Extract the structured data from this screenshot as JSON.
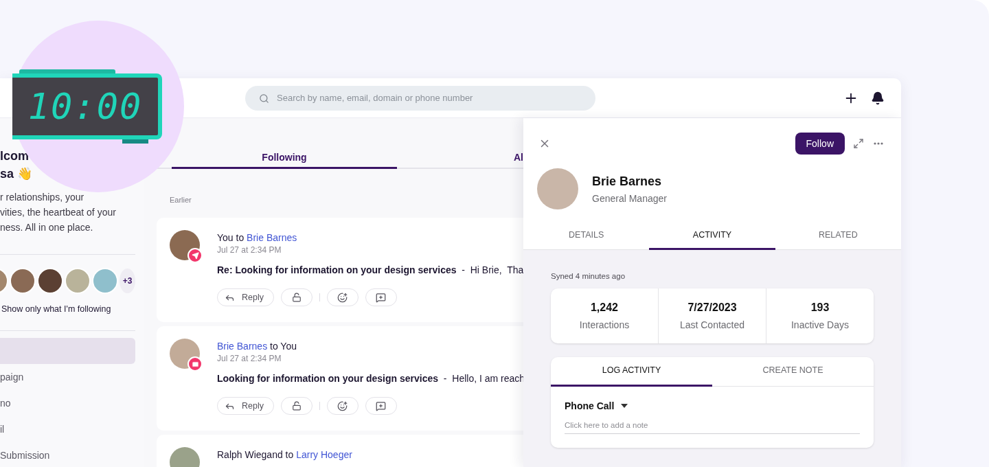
{
  "clock": {
    "time": "10:00"
  },
  "header": {
    "search": {
      "placeholder": "Search by name, email, domain or phone number"
    }
  },
  "sidebar": {
    "welcome_lines": [
      "lcom",
      "sa 👋"
    ],
    "intro_lines": [
      "r relationships, your",
      "vities, the heartbeat of your",
      "ness. All in one place."
    ],
    "avatars_more": "+3",
    "follow_filter": "Show only what I'm following",
    "nav_items": [
      {
        "selected": true
      },
      {
        "label": "paign",
        "selected": false
      },
      {
        "label": "no",
        "selected": false
      },
      {
        "label": "il",
        "selected": false
      },
      {
        "label": "Submission",
        "selected": false
      }
    ]
  },
  "feed": {
    "tabs": [
      {
        "label": "Following",
        "selected": true
      },
      {
        "label": "Al",
        "selected": false
      }
    ],
    "section": "Earlier",
    "messages": [
      {
        "kind": "sent",
        "heading": [
          {
            "kind": "plain",
            "text": "You to"
          },
          {
            "kind": "link",
            "text": "Brie Barnes"
          }
        ],
        "time": "Jul 27 at 2:34 PM",
        "text": "**Re: Looking for information on your design services**  -  Hi Brie,  Tha",
        "reply": "Reply"
      },
      {
        "kind": "mail",
        "heading": [
          {
            "kind": "link",
            "text": "Brie Barnes"
          },
          {
            "kind": "plain",
            "text": "to You"
          }
        ],
        "time": "Jul 27 at 2:34 PM",
        "text": "**Looking for information on your design services**  -  Hello, I am reach",
        "reply": "Reply"
      },
      {
        "heading": [
          {
            "kind": "plain",
            "text": "Ralph Wiegand to"
          },
          {
            "kind": "link",
            "text": "Larry Hoeger"
          }
        ]
      }
    ]
  },
  "drawer": {
    "follow": "Follow",
    "contact": {
      "name": "Brie Barnes",
      "title": "General Manager"
    },
    "tabs": [
      {
        "label": "DETAILS",
        "selected": false
      },
      {
        "label": "ACTIVITY",
        "selected": true
      },
      {
        "label": "RELATED",
        "selected": false
      }
    ],
    "synced": "Syned 4 minutes ago",
    "stats": [
      {
        "value": "1,242",
        "label": "Interactions"
      },
      {
        "value": "7/27/2023",
        "label": "Last Contacted"
      },
      {
        "value": "193",
        "label": "Inactive Days"
      }
    ],
    "log_tabs": [
      {
        "label": "LOG ACTIVITY",
        "selected": true
      },
      {
        "label": "CREATE NOTE",
        "selected": false
      }
    ],
    "activity_type": "Phone Call",
    "note": {
      "placeholder": "Click here to add a note"
    }
  }
}
